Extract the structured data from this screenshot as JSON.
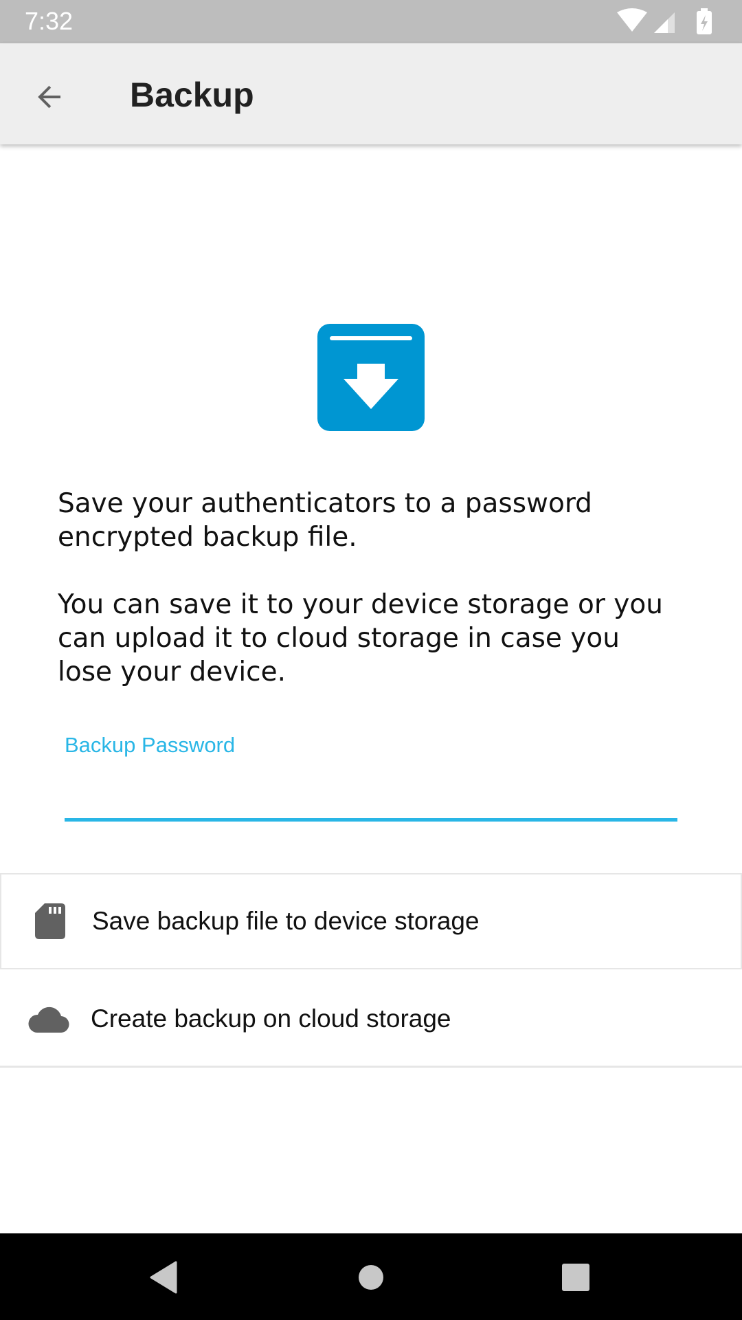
{
  "status_bar": {
    "time": "7:32",
    "icons": [
      "wifi-icon",
      "cell-signal-icon",
      "battery-charging-icon"
    ]
  },
  "app_bar": {
    "back_icon": "arrow-back-icon",
    "title": "Backup"
  },
  "hero": {
    "icon": "archive-download-icon",
    "color": "#0096d2"
  },
  "description": {
    "paragraph_1": "Save your authenticators to a password encrypted backup file.",
    "paragraph_2": "You can save it to your device storage or you can upload it to cloud storage in case you lose your device."
  },
  "password_field": {
    "label": "Backup Password",
    "value": "",
    "accent_color": "#29b6e6"
  },
  "options": [
    {
      "icon": "sd-card-icon",
      "label": "Save backup file to device storage"
    },
    {
      "icon": "cloud-icon",
      "label": "Create backup on cloud storage"
    }
  ],
  "nav_bar": {
    "icons": [
      "nav-back-icon",
      "nav-home-icon",
      "nav-recents-icon"
    ]
  }
}
